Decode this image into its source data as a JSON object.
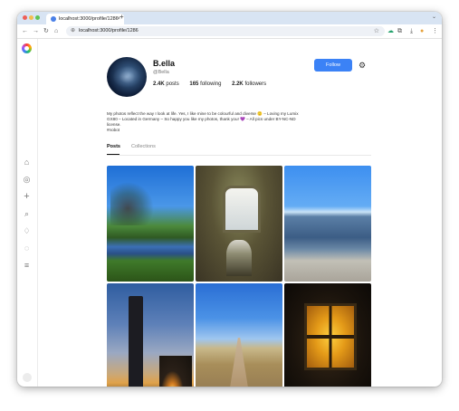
{
  "browser": {
    "tab_title": "localhost:3000/profile/1286",
    "tab_close": "×",
    "new_tab": "+",
    "tab_menu": "⌄",
    "url": "localhost:3000/profile/1286",
    "nav": {
      "back": "←",
      "forward": "→",
      "reload": "↻",
      "home": "⌂"
    },
    "lock": "⊕",
    "bookmark": "☆",
    "toolbar_icons": [
      "☁",
      "⧉",
      "⤓",
      "●",
      "⋮"
    ]
  },
  "sidebar": {
    "items": [
      {
        "name": "home",
        "glyph": "⌂"
      },
      {
        "name": "explore",
        "glyph": "◎"
      },
      {
        "name": "create",
        "glyph": "+"
      },
      {
        "name": "search",
        "glyph": "⌕"
      },
      {
        "name": "notifications",
        "glyph": "♢"
      },
      {
        "name": "messages",
        "glyph": "◌"
      },
      {
        "name": "menu",
        "glyph": "≡"
      }
    ]
  },
  "profile": {
    "name": "B.ella",
    "handle": "@Bella",
    "posts_count": "2.4K",
    "posts_label": "posts",
    "following_count": "165",
    "following_label": "following",
    "followers_count": "2.2K",
    "followers_label": "followers",
    "follow_button": "Follow",
    "settings_glyph": "⚙",
    "bio_lines": [
      "My photos reflect the way I look at life. Yes, I like mine to be colourful and diverse 🙂 – Loving my Lumix",
      "GX80 – Located in Germany – So happy you like my photos, thank you! 💜 – All pics under BY-NC-ND",
      "license.",
      "#nobot"
    ]
  },
  "tabs": {
    "posts": "Posts",
    "collections": "Collections"
  },
  "scroll_glyph": "⌃"
}
